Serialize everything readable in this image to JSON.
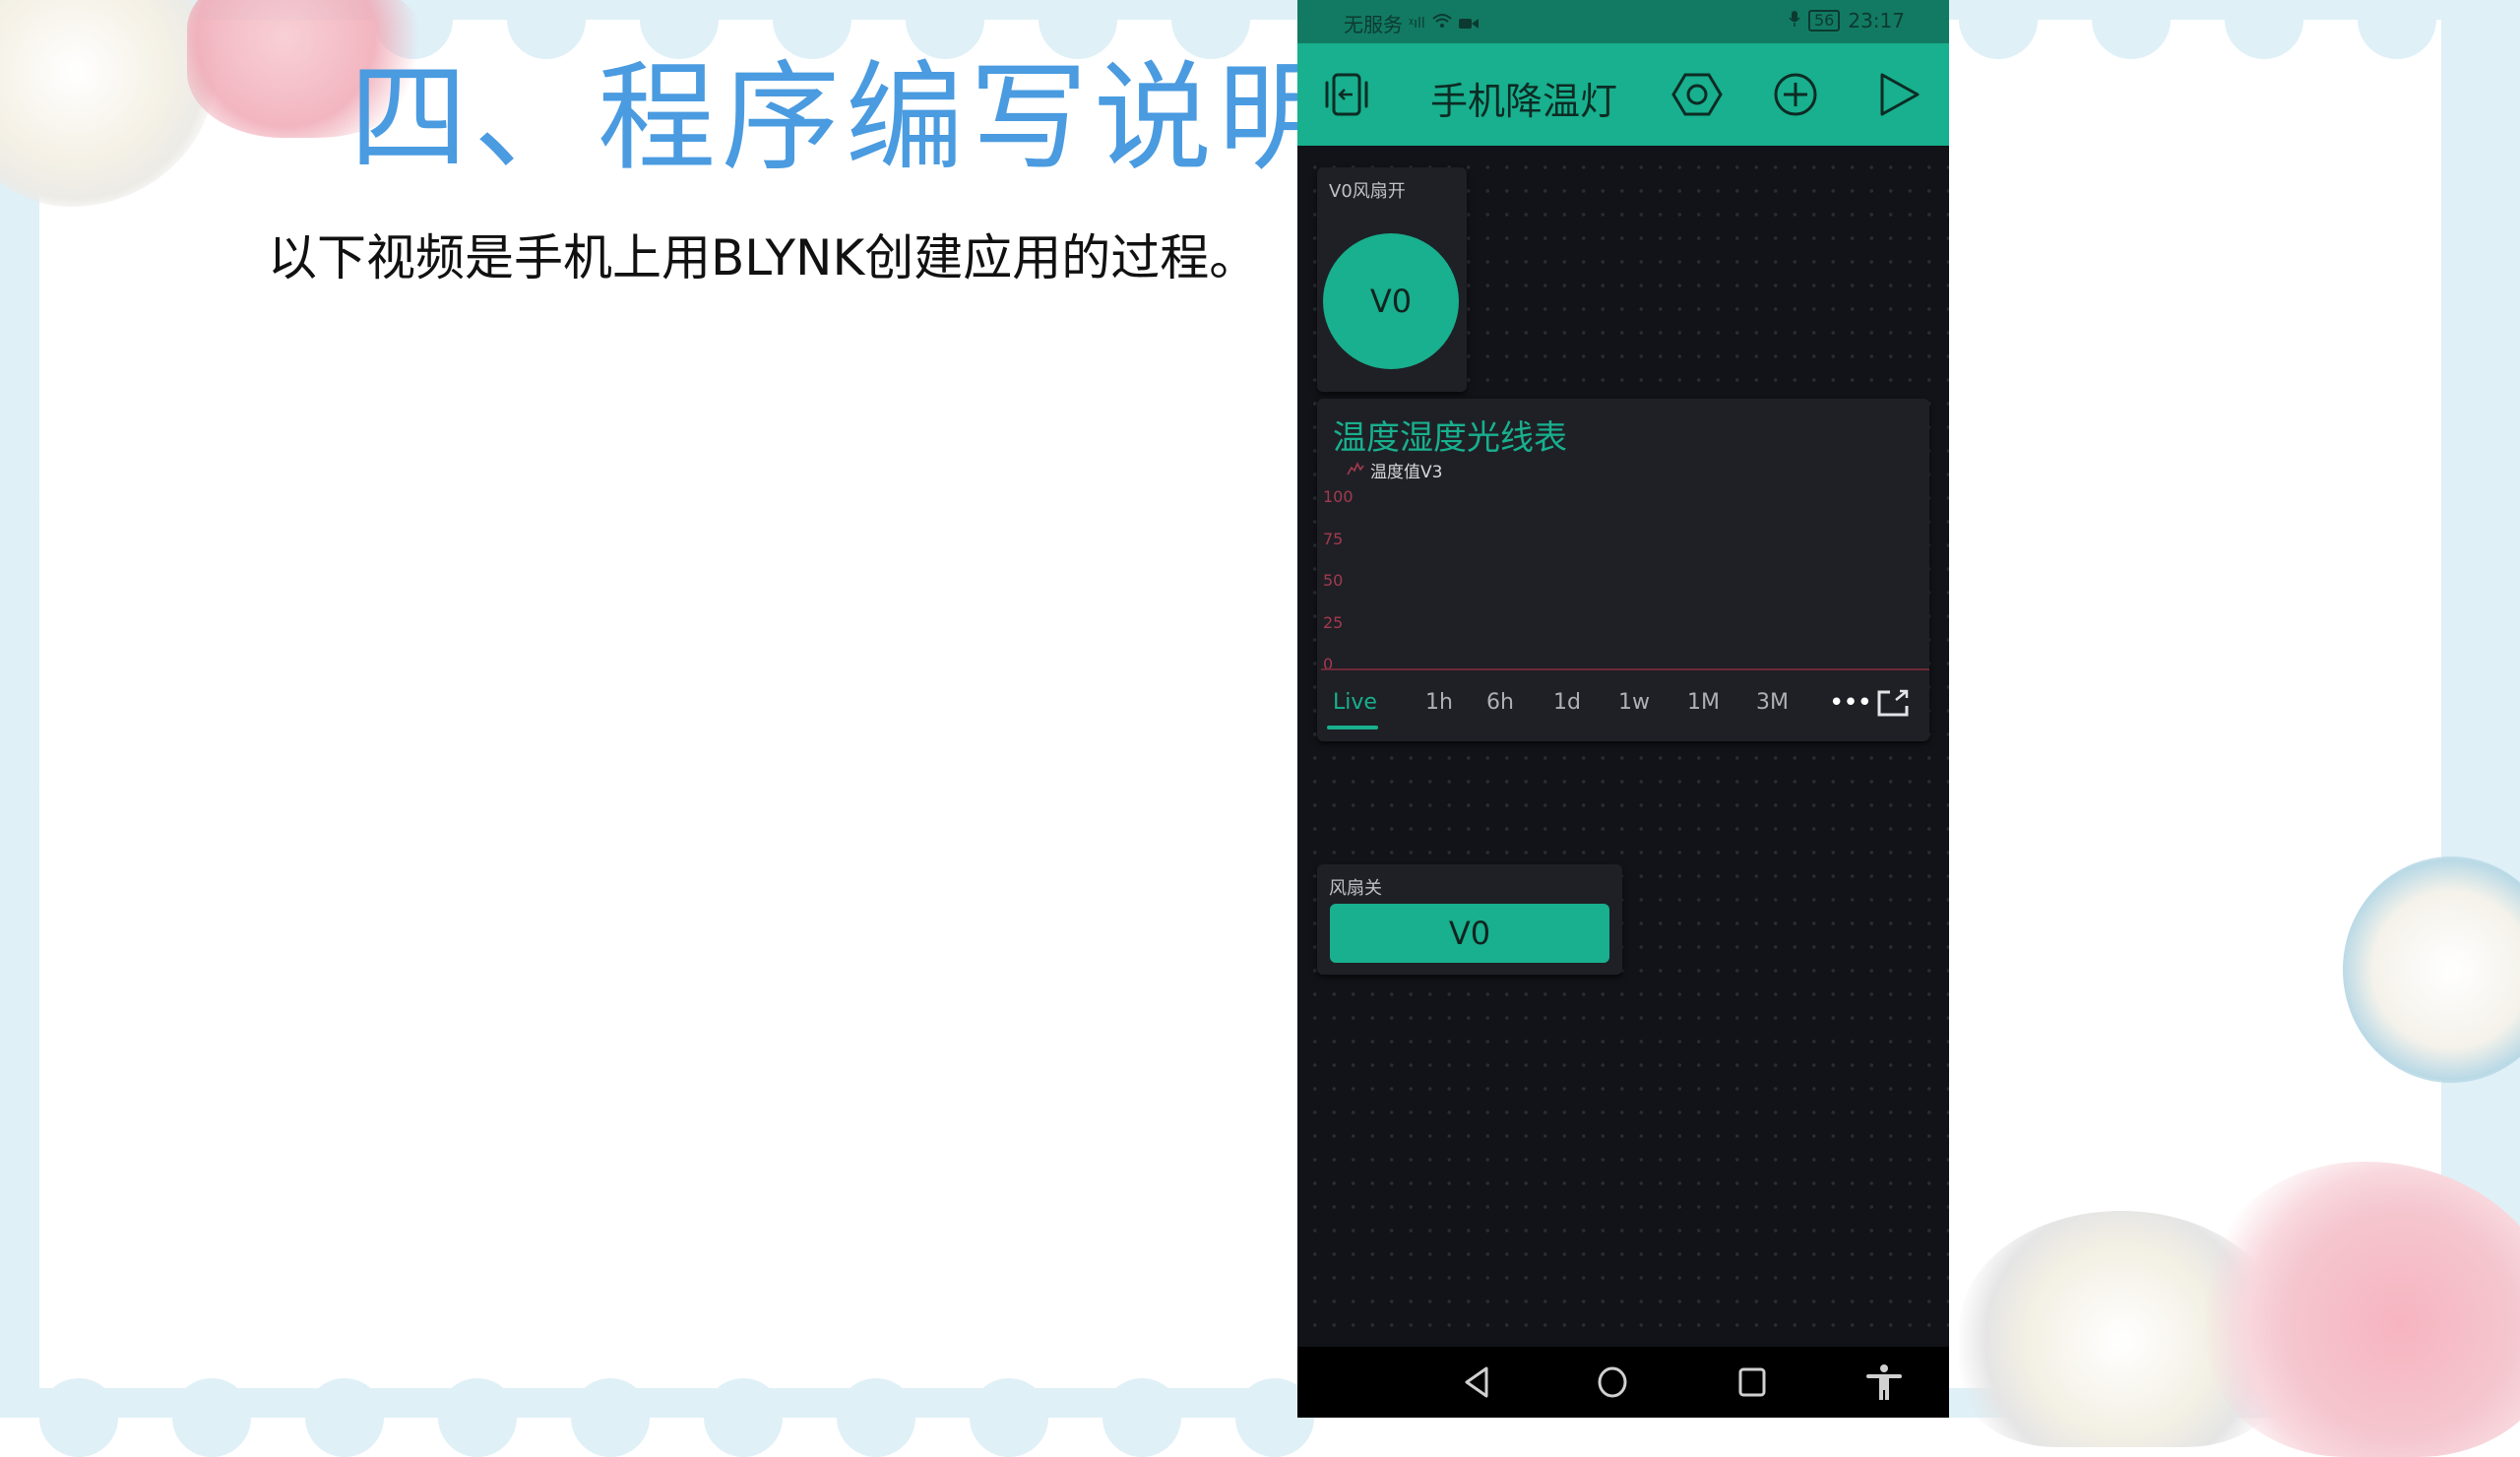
{
  "slide": {
    "title": "四、程序编写说明",
    "body": "以下视频是手机上用BLYNK创建应用的过程。",
    "colors": {
      "title": "#4a9be0",
      "body": "#111111",
      "border": "#dff0f7"
    }
  },
  "phone": {
    "status_bar": {
      "carrier": "无服务",
      "signal_icon": "signal-no-service-icon",
      "wifi_icon": "wifi-icon",
      "camera_icon": "video-camera-icon",
      "mic_icon": "microphone-icon",
      "battery": "56",
      "time": "23:17"
    },
    "app_bar": {
      "title": "手机降温灯",
      "icons": [
        "exit-project-icon",
        "settings-nut-icon",
        "add-widget-icon",
        "play-icon"
      ]
    },
    "widgets": {
      "button_widget": {
        "label": "V0风扇开",
        "pin": "V0"
      },
      "chart_widget": {
        "title": "温度湿度光线表",
        "legend": "温度值V3",
        "y_ticks": [
          "100",
          "75",
          "50",
          "25",
          "0"
        ],
        "range_tabs": [
          "Live",
          "1h",
          "6h",
          "1d",
          "1w",
          "1M",
          "3M"
        ],
        "active_tab": "Live",
        "more_icon": "more-dots-icon",
        "expand_icon": "fullscreen-open-icon"
      },
      "styled_button_widget": {
        "label": "风扇关",
        "pin": "V0"
      }
    },
    "nav_bar": [
      "back-icon",
      "home-icon",
      "recents-icon",
      "accessibility-icon"
    ],
    "colors": {
      "accent": "#18b08e",
      "status_bar": "#127a63",
      "canvas": "#121318",
      "widget": "#1f2026",
      "chart_axis": "#a33a4e"
    }
  },
  "chart_data": {
    "type": "line",
    "title": "温度湿度光线表",
    "series": [
      {
        "name": "温度值V3",
        "values": []
      }
    ],
    "xlabel": "",
    "ylabel": "",
    "ylim": [
      0,
      100
    ],
    "yticks": [
      0,
      25,
      50,
      75,
      100
    ],
    "grid": false,
    "legend": "top-left"
  }
}
